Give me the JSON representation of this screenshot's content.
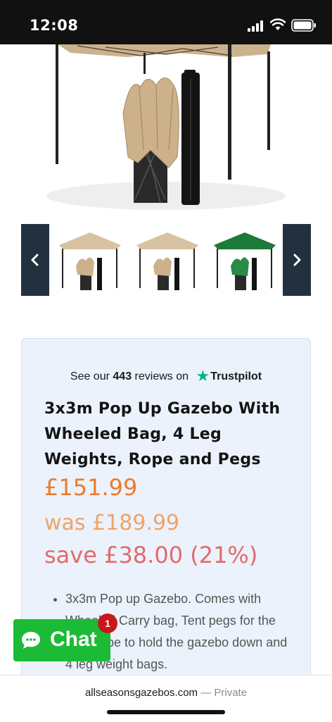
{
  "status": {
    "time": "12:08"
  },
  "hero": {
    "image": "gazebo-with-bag-photo"
  },
  "carousel": {
    "prev_icon": "chevron-left-icon",
    "next_icon": "chevron-right-icon",
    "thumbnails": [
      {
        "color": "#d8c2a1",
        "image": "beige-gazebo-thumbnail"
      },
      {
        "color": "#d8c2a1",
        "image": "beige-gazebo-thumbnail"
      },
      {
        "color": "#1e7a3a",
        "image": "green-gazebo-thumbnail"
      }
    ]
  },
  "trustpilot": {
    "prefix": "See our",
    "count": "443",
    "suffix": "reviews on",
    "brand": "Trustpilot",
    "star_color": "#00b67a"
  },
  "product": {
    "title": "3x3m Pop Up Gazebo With Wheeled Bag, 4 Leg Weights, Rope and Pegs",
    "price": "£151.99",
    "was": "was £189.99",
    "save": "save £38.00 (21%)",
    "bullets": [
      "3x3m Pop up Gazebo. Comes with Wheeled Carry bag, Tent pegs for the legs, rope to hold the gazebo down and 4 leg weight bags."
    ]
  },
  "chat": {
    "label": "Chat",
    "badge": "1",
    "color": "#1bbb36"
  },
  "browser": {
    "domain": "allseasonsgazebos.com",
    "separator": "—",
    "mode": "Private"
  }
}
